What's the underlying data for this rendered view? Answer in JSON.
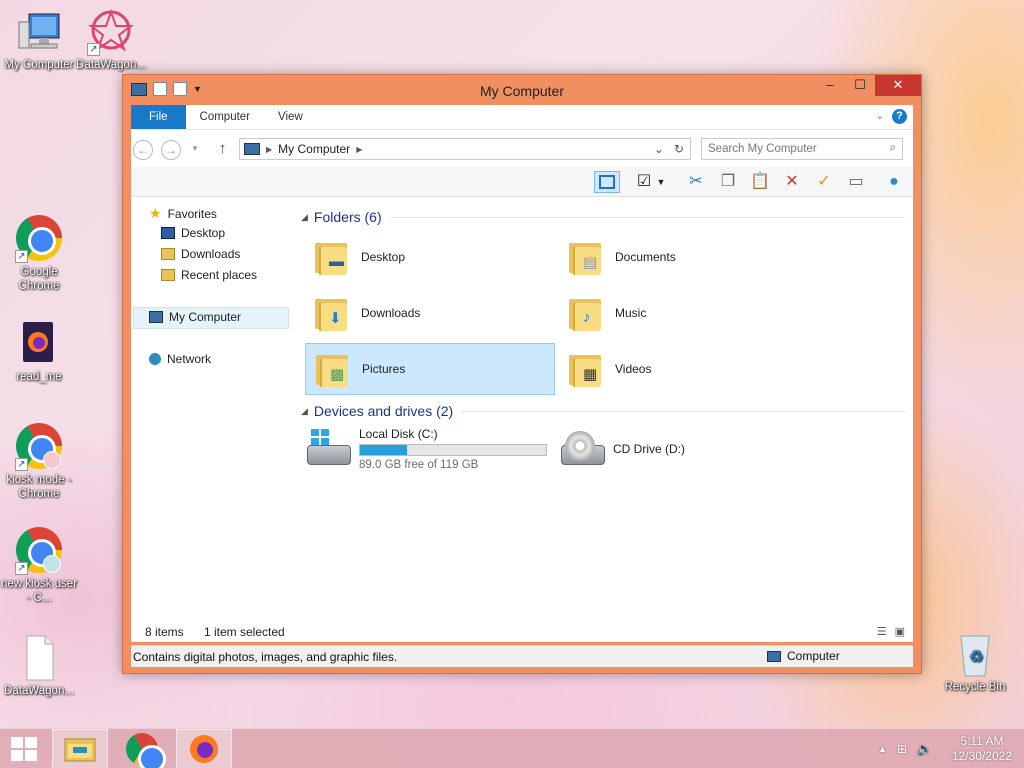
{
  "desktop": {
    "icons": [
      {
        "label": "My Computer"
      },
      {
        "label": "DataWagon..."
      },
      {
        "label": "Google Chrome"
      },
      {
        "label": "read_me"
      },
      {
        "label": "kiosk mode - Chrome"
      },
      {
        "label": "new kiosk user - C..."
      },
      {
        "label": "DataWagon..."
      },
      {
        "label": "Recycle Bin"
      }
    ]
  },
  "window": {
    "title": "My Computer",
    "controls": {
      "minimize": "–",
      "maximize": "☐",
      "close": "✕"
    },
    "ribbon_tabs": [
      "File",
      "Computer",
      "View"
    ],
    "help_label": "?",
    "address": {
      "path": "My Computer"
    },
    "search": {
      "placeholder": "Search My Computer"
    },
    "nav_pane": {
      "favorites": "Favorites",
      "favorites_items": [
        "Desktop",
        "Downloads",
        "Recent places"
      ],
      "computer": "My Computer",
      "network": "Network"
    },
    "groups": {
      "folders_label": "Folders (6)",
      "devices_label": "Devices and drives (2)"
    },
    "folders": [
      {
        "name": "Desktop"
      },
      {
        "name": "Documents"
      },
      {
        "name": "Downloads"
      },
      {
        "name": "Music"
      },
      {
        "name": "Pictures",
        "selected": true
      },
      {
        "name": "Videos"
      }
    ],
    "drives": [
      {
        "name": "Local Disk (C:)",
        "free_text": "89.0 GB free of 119 GB",
        "used_fraction": 0.25
      },
      {
        "name": "CD Drive (D:)"
      }
    ],
    "status": {
      "items": "8 items",
      "selected": "1 item selected"
    },
    "info": {
      "description": "Contains digital photos, images, and graphic files.",
      "location": "Computer"
    }
  },
  "taskbar": {
    "clock_time": "5:11 AM",
    "clock_date": "12/30/2022"
  },
  "colors": {
    "titlebar": "#f08f62",
    "accent": "#1979ca",
    "close": "#c7372f",
    "selection": "#cce8ff"
  }
}
